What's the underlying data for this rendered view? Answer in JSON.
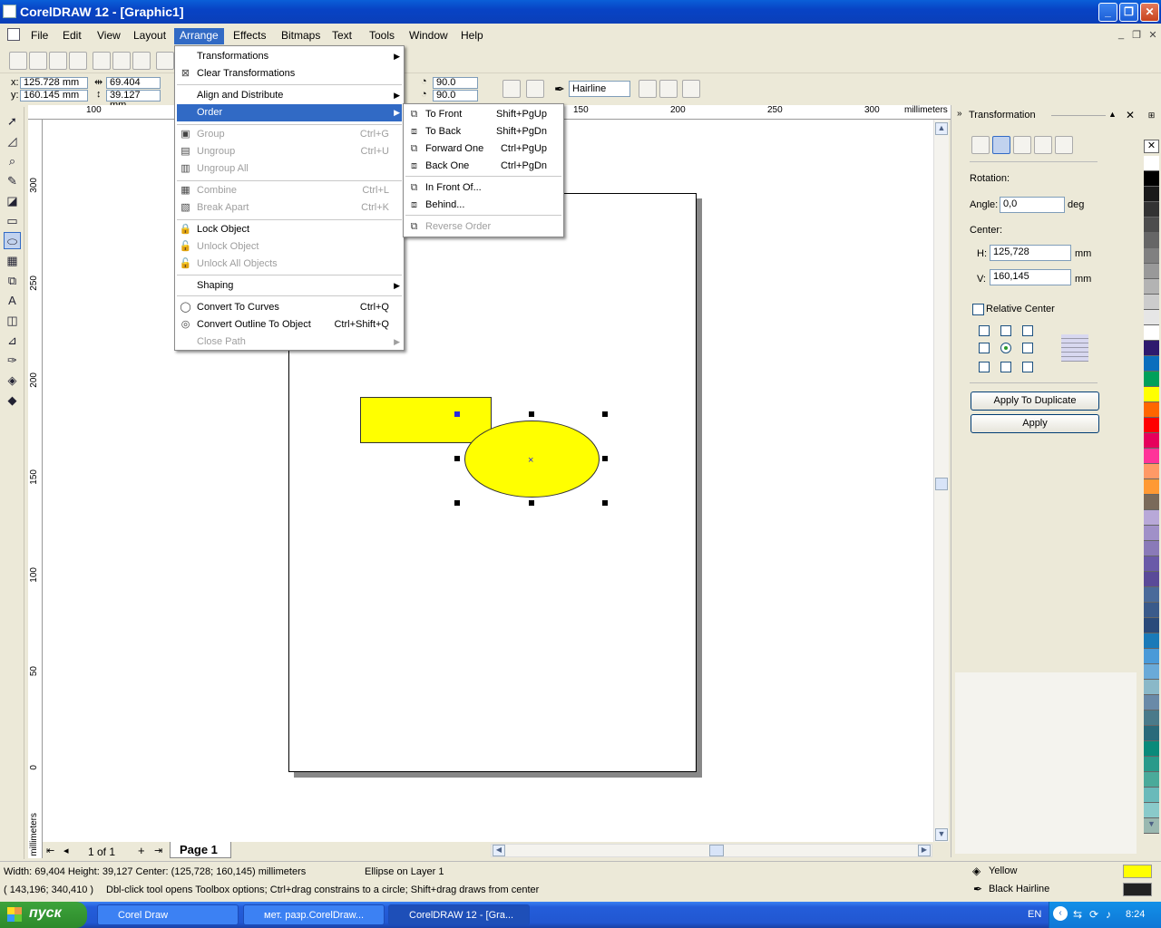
{
  "window": {
    "title": "CorelDRAW 12 - [Graphic1]"
  },
  "menubar": [
    "File",
    "Edit",
    "View",
    "Layout",
    "Arrange",
    "Effects",
    "Bitmaps",
    "Text",
    "Tools",
    "Window",
    "Help"
  ],
  "property_bar": {
    "x": "125.728 mm",
    "y": "160.145 mm",
    "width": "69.404 mm",
    "height": "39.127 mm",
    "angle1": "90.0",
    "angle2": "90.0",
    "outline": "Hairline"
  },
  "arrange_menu": [
    {
      "label": "Transformations",
      "key": "",
      "disabled": false,
      "submenu": true
    },
    {
      "label": "Clear Transformations",
      "key": "",
      "disabled": false,
      "submenu": false
    },
    {
      "label": "Align and Distribute",
      "key": "",
      "disabled": false,
      "submenu": true
    },
    {
      "label": "Order",
      "key": "",
      "disabled": false,
      "submenu": true,
      "highlight": true
    },
    {
      "label": "Group",
      "key": "Ctrl+G",
      "disabled": true
    },
    {
      "label": "Ungroup",
      "key": "Ctrl+U",
      "disabled": true
    },
    {
      "label": "Ungroup All",
      "key": "",
      "disabled": true
    },
    {
      "label": "Combine",
      "key": "Ctrl+L",
      "disabled": true
    },
    {
      "label": "Break  Apart",
      "key": "Ctrl+K",
      "disabled": true
    },
    {
      "label": "Lock Object",
      "key": "",
      "disabled": false
    },
    {
      "label": "Unlock Object",
      "key": "",
      "disabled": true
    },
    {
      "label": "Unlock All Objects",
      "key": "",
      "disabled": true
    },
    {
      "label": "Shaping",
      "key": "",
      "disabled": false,
      "submenu": true
    },
    {
      "label": "Convert To Curves",
      "key": "Ctrl+Q",
      "disabled": false
    },
    {
      "label": "Convert Outline To Object",
      "key": "Ctrl+Shift+Q",
      "disabled": false
    },
    {
      "label": "Close Path",
      "key": "",
      "disabled": true,
      "submenu": true
    }
  ],
  "order_submenu": [
    {
      "label": "To Front",
      "key": "Shift+PgUp",
      "disabled": false
    },
    {
      "label": "To Back",
      "key": "Shift+PgDn",
      "disabled": false
    },
    {
      "label": "Forward One",
      "key": "Ctrl+PgUp",
      "disabled": false
    },
    {
      "label": "Back One",
      "key": "Ctrl+PgDn",
      "disabled": false
    },
    {
      "label": "In Front Of...",
      "key": "",
      "disabled": false
    },
    {
      "label": "Behind...",
      "key": "",
      "disabled": false
    },
    {
      "label": "Reverse Order",
      "key": "",
      "disabled": true
    }
  ],
  "rulers": {
    "h_ticks": [
      "100",
      "150",
      "200",
      "250",
      "300"
    ],
    "h_unit": "millimeters",
    "v_ticks": [
      "300",
      "250",
      "200",
      "150",
      "100",
      "50",
      "0"
    ],
    "v_unit": "millimeters"
  },
  "page_nav": {
    "count": "1 of 1",
    "tab": "Page 1"
  },
  "docker": {
    "title": "Transformation",
    "rotation_label": "Rotation:",
    "angle_label": "Angle:",
    "angle_value": "0,0",
    "angle_unit": "deg",
    "center_label": "Center:",
    "h_label": "H:",
    "h_value": "125,728",
    "h_unit": "mm",
    "v_label": "V:",
    "v_value": "160,145",
    "v_unit": "mm",
    "relative_center": "Relative Center",
    "apply_duplicate": "Apply To Duplicate",
    "apply": "Apply"
  },
  "palette": [
    "#ffffff",
    "#000000",
    "#1a1a1a",
    "#333333",
    "#4d4d4d",
    "#666666",
    "#808080",
    "#999999",
    "#b3b3b3",
    "#cccccc",
    "#e6e6e6",
    "#ffffff",
    "#2e1a6e",
    "#0a6ebd",
    "#00a05a",
    "#ffff00",
    "#ff6600",
    "#ff0000",
    "#e6005c",
    "#ff3399",
    "#ff9966",
    "#ff9933",
    "#7a6a5a",
    "#b8a8d8",
    "#a090c8",
    "#8a7ab8",
    "#6a5aa8",
    "#5a4a98",
    "#4a6a9a",
    "#3a5a8a",
    "#2a4a7a",
    "#1a7ab8",
    "#4a9ad8",
    "#6aaad8",
    "#8ab8c8",
    "#6a8aa8",
    "#4a7a8a",
    "#2a6a7a",
    "#0a8a7a",
    "#2a9a8a",
    "#4aaa9a",
    "#6ababa",
    "#8acaca",
    "#9ab8b0"
  ],
  "status": {
    "line1": "Width: 69,404  Height: 39,127  Center: (125,728; 160,145)  millimeters",
    "layer": "Ellipse on Layer 1",
    "line2": "( 143,196; 340,410 )",
    "hint": "Dbl-click tool opens Toolbox options; Ctrl+drag constrains to a circle; Shift+drag draws from center",
    "fill_label": "Yellow",
    "outline_label": "Black  Hairline",
    "fill_color": "#ffff00",
    "outline_color": "#222222"
  },
  "taskbar": {
    "start": "пуск",
    "tasks": [
      "Corel Draw",
      "мет. разр.CorelDraw...",
      "CorelDRAW 12 - [Gra..."
    ],
    "lang": "EN",
    "time": "8:24"
  }
}
